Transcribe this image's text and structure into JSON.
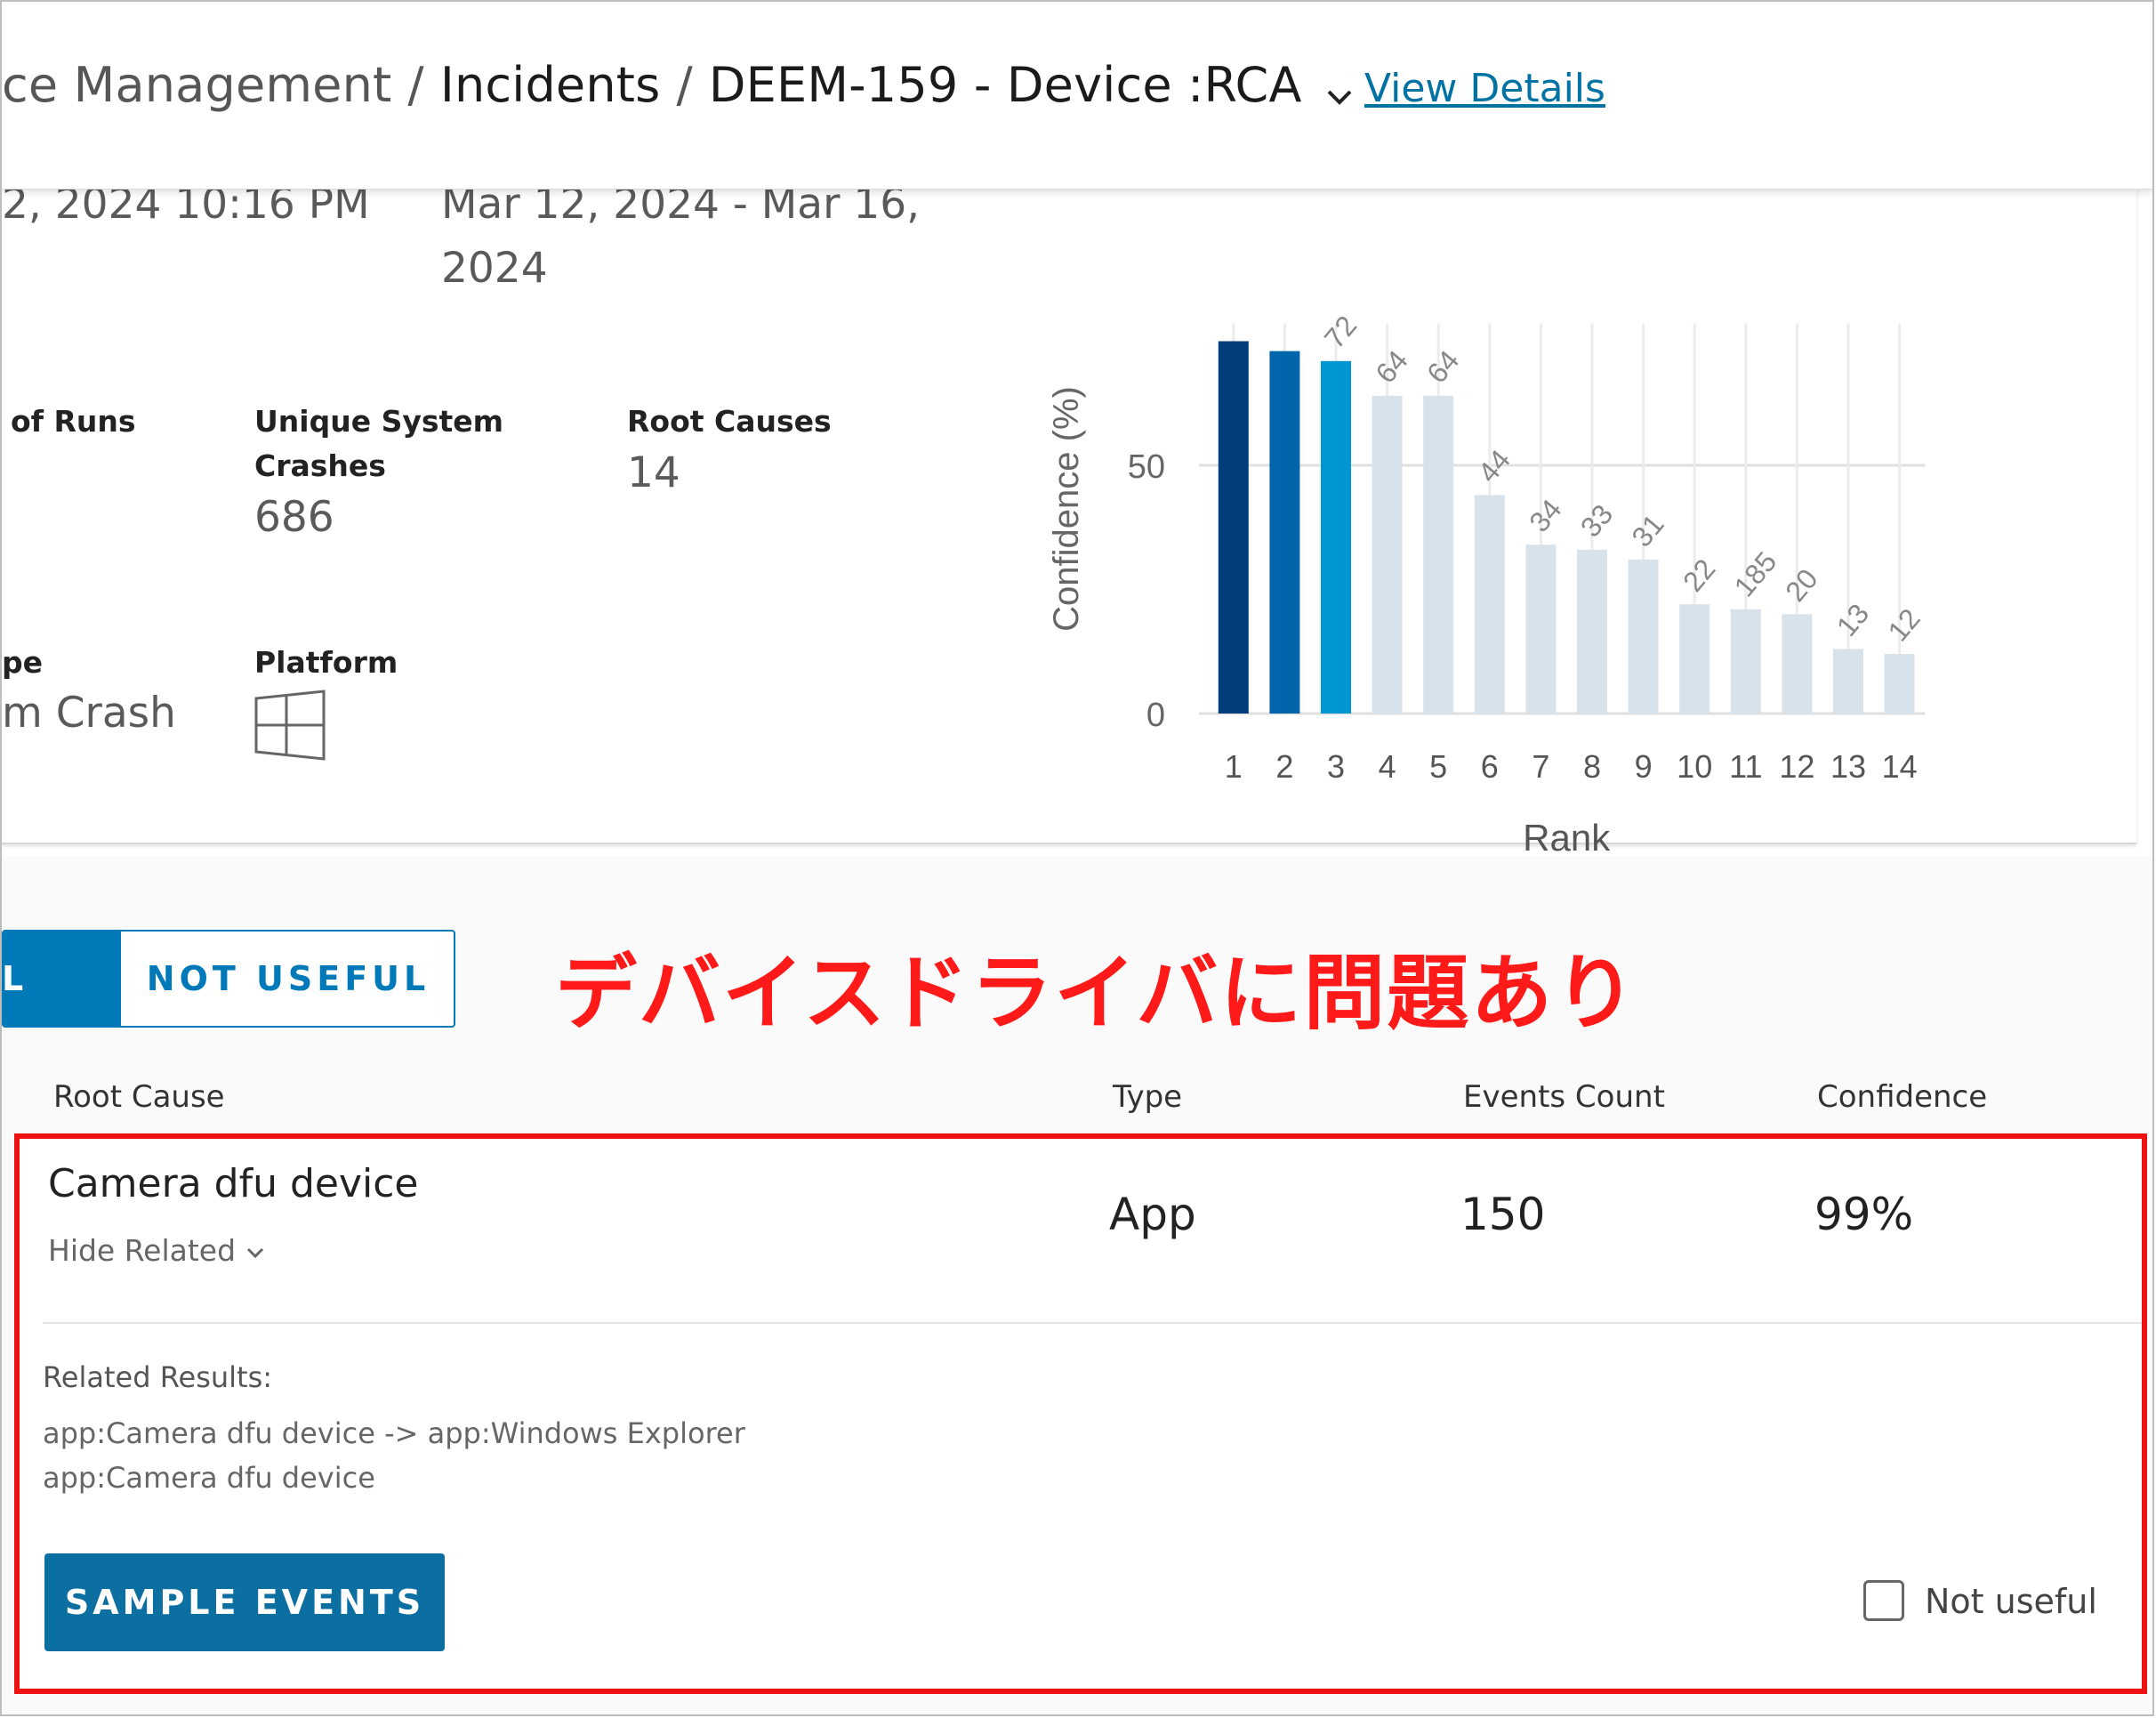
{
  "header": {
    "breadcrumb": [
      "ce Management",
      "Incidents",
      "DEEM-159 - Device :RCA"
    ],
    "separator": "/",
    "view_details": "View Details"
  },
  "summary": {
    "created_time": "2, 2024 10:16 PM",
    "date_range_line1": "Mar 12, 2024 - Mar 16,",
    "date_range_line2": "2024",
    "runs_label": "of Runs",
    "crashes_label_line1": "Unique System",
    "crashes_label_line2": "Crashes",
    "crashes_value": "686",
    "root_causes_label": "Root Causes",
    "root_causes_value": "14",
    "type_label": "pe",
    "type_value": "m Crash",
    "platform_label": "Platform",
    "platform_icon": "windows-icon"
  },
  "chart_data": {
    "type": "bar",
    "categories": [
      "1",
      "2",
      "3",
      "4",
      "5",
      "6",
      "7",
      "8",
      "9",
      "10",
      "11",
      "12",
      "13",
      "14"
    ],
    "values": [
      75,
      73,
      71,
      64,
      64,
      44,
      34,
      33,
      31,
      22,
      185,
      20,
      13,
      12
    ],
    "plotted_heights": [
      75,
      73,
      71,
      64,
      64,
      44,
      34,
      33,
      31,
      22,
      21,
      20,
      13,
      12
    ],
    "data_labels": [
      "",
      "",
      "72",
      "64",
      "64",
      "44",
      "34",
      "33",
      "31",
      "22",
      "185",
      "20",
      "13",
      "12"
    ],
    "xlabel": "Rank",
    "ylabel": "Confidence (%)",
    "yticks": [
      "0",
      "50"
    ],
    "ylim": [
      0,
      75
    ],
    "colors": [
      "#003d79",
      "#0065ab",
      "#0095d3",
      "#d7e2ea",
      "#d7e2ea",
      "#d7e2ea",
      "#d7e2ea",
      "#d7e2ea",
      "#d7e2ea",
      "#d7e2ea",
      "#d7e2ea",
      "#d7e2ea",
      "#d7e2ea",
      "#d7e2ea"
    ],
    "grid": true
  },
  "tabs": {
    "useful": "L",
    "not_useful": "NOT USEFUL"
  },
  "annotation": "デバイスドライバに問題あり",
  "table": {
    "columns": [
      "Root Cause",
      "Type",
      "Events Count",
      "Confidence"
    ],
    "row": {
      "root_cause": "Camera dfu device",
      "hide_related": "Hide Related",
      "type": "App",
      "events_count": "150",
      "confidence": "99%",
      "related_label": "Related Results:",
      "related_items": [
        "app:Camera dfu device -> app:Windows Explorer",
        "app:Camera dfu device"
      ],
      "sample_events": "SAMPLE EVENTS",
      "not_useful": "Not useful"
    }
  },
  "colors": {
    "accent": "#0079b8",
    "annotation": "#ff1a1a"
  }
}
